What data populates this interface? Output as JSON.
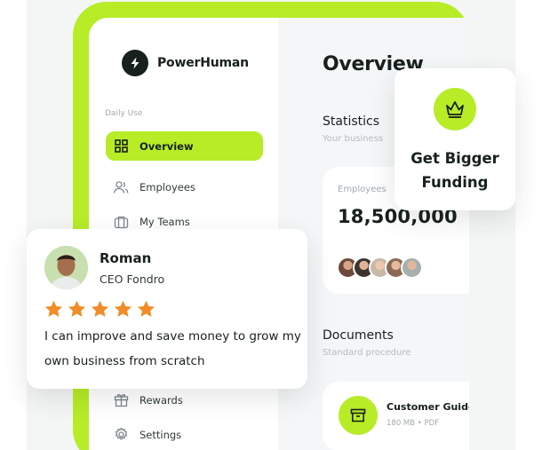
{
  "brand": {
    "name": "PowerHuman",
    "logo_icon": "lightning-bolt-icon"
  },
  "sidebar": {
    "section_label": "Daily Use",
    "items": [
      {
        "label": "Overview",
        "icon": "grid-icon",
        "active": true
      },
      {
        "label": "Employees",
        "icon": "users-icon",
        "active": false
      },
      {
        "label": "My Teams",
        "icon": "briefcase-icon",
        "active": false
      },
      {
        "label": "Rewards",
        "icon": "gift-icon",
        "active": false
      },
      {
        "label": "Settings",
        "icon": "gear-icon",
        "active": false
      }
    ]
  },
  "main": {
    "title": "Overview",
    "statistics": {
      "title": "Statistics",
      "subtitle": "Your business",
      "employees_label": "Employees",
      "employees_value": "18,500,000"
    },
    "documents": {
      "title": "Documents",
      "subtitle": "Standard procedure",
      "file_name": "Customer Guide",
      "file_meta": "180 MB • PDF",
      "file_icon": "archive-box-icon"
    }
  },
  "funding_card": {
    "line1": "Get Bigger",
    "line2": "Funding",
    "icon": "crown-icon"
  },
  "review": {
    "name": "Roman",
    "role": "CEO Fondro",
    "rating": 5,
    "rating_max": 5,
    "quote": "I can improve and save money to grow my own business from scratch"
  },
  "colors": {
    "accent": "#b7ec27",
    "dark": "#17201c",
    "star": "#f28c28",
    "muted_text": "#a3aab0",
    "panel_bg": "#f4f6f8"
  }
}
